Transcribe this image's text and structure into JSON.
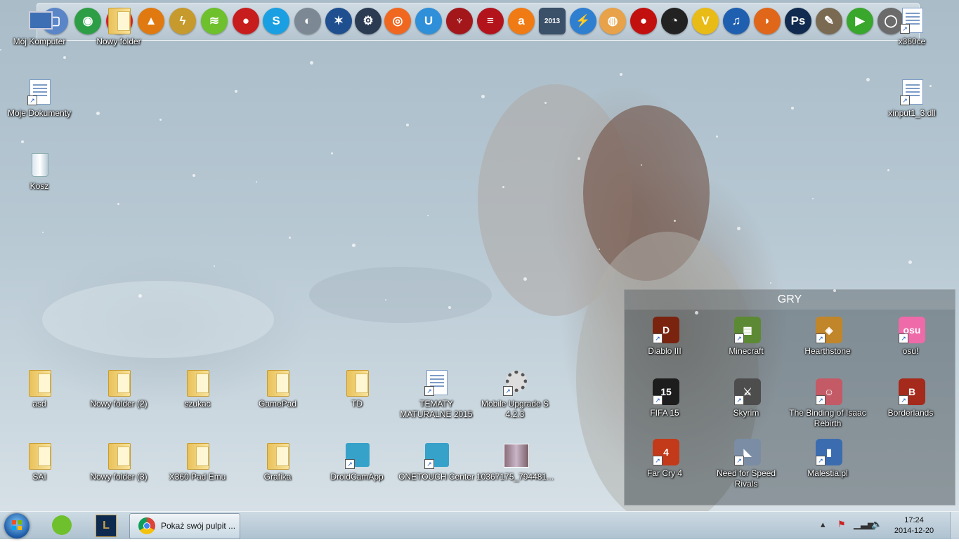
{
  "dock": {
    "icons": [
      {
        "name": "computer-icon",
        "glyph": "▢",
        "color": "#5a86c8"
      },
      {
        "name": "chrome-icon",
        "glyph": "◉",
        "color": "#2e9e46"
      },
      {
        "name": "opera-icon",
        "glyph": "O",
        "color": "#d5222b"
      },
      {
        "name": "aimp-icon",
        "glyph": "▲",
        "color": "#e07a10"
      },
      {
        "name": "winamp-icon",
        "glyph": "ϟ",
        "color": "#c69a2c"
      },
      {
        "name": "spotify-icon",
        "glyph": "≋",
        "color": "#6ec02d"
      },
      {
        "name": "speaker-icon",
        "glyph": "●",
        "color": "#c81d1d"
      },
      {
        "name": "skype-icon",
        "glyph": "S",
        "color": "#1aa0e2"
      },
      {
        "name": "steam-alt-icon",
        "glyph": "◐",
        "color": "#7d8895"
      },
      {
        "name": "battlenet-icon",
        "glyph": "✶",
        "color": "#1f4f8f"
      },
      {
        "name": "steam-icon",
        "glyph": "⚙",
        "color": "#2a3b52"
      },
      {
        "name": "origin-icon",
        "glyph": "◎",
        "color": "#f0681f"
      },
      {
        "name": "uplay-icon",
        "glyph": "U",
        "color": "#2f8fd8"
      },
      {
        "name": "hawk-icon",
        "glyph": "♆",
        "color": "#a3171b"
      },
      {
        "name": "stripes-icon",
        "glyph": "≡",
        "color": "#b3141b"
      },
      {
        "name": "avast-icon",
        "glyph": "a",
        "color": "#f07b14"
      },
      {
        "name": "game-2013-icon",
        "glyph": "2013",
        "color": "#3b5069"
      },
      {
        "name": "speedtest-icon",
        "glyph": "⚡",
        "color": "#2f7fd1"
      },
      {
        "name": "disc-icon",
        "glyph": "◍",
        "color": "#e7a24a"
      },
      {
        "name": "record-icon",
        "glyph": "●",
        "color": "#c2100f"
      },
      {
        "name": "obs-icon",
        "glyph": "◔",
        "color": "#222222"
      },
      {
        "name": "v-logo-icon",
        "glyph": "V",
        "color": "#e9bb16"
      },
      {
        "name": "headphones-icon",
        "glyph": "♫",
        "color": "#1f5fb0"
      },
      {
        "name": "shell-icon",
        "glyph": "◗",
        "color": "#e0661a"
      },
      {
        "name": "photoshop-icon",
        "glyph": "Ps",
        "color": "#102b4f"
      },
      {
        "name": "gimp-icon",
        "glyph": "✎",
        "color": "#7a6a52"
      },
      {
        "name": "play-icon",
        "glyph": "▶",
        "color": "#39a62c"
      },
      {
        "name": "steering-wheel-icon",
        "glyph": "◯",
        "color": "#6b6b6b"
      }
    ]
  },
  "desktop": {
    "left_top": [
      {
        "label": "Mój Komputer",
        "glyph": "computer"
      },
      {
        "label": "Nowy folder",
        "glyph": "folder"
      },
      {
        "label": "Moje Dokumenty",
        "glyph": "doc"
      },
      {
        "label": "Kosz",
        "glyph": "bin"
      }
    ],
    "right_top": [
      {
        "label": "x360ce",
        "glyph": "doc"
      },
      {
        "label": "xinput1_3.dll",
        "glyph": "doc"
      }
    ],
    "row1": [
      {
        "label": "asd",
        "glyph": "folder"
      },
      {
        "label": "Nowy folder (2)",
        "glyph": "folder"
      },
      {
        "label": "szukac",
        "glyph": "folder"
      },
      {
        "label": "GamePad",
        "glyph": "folder"
      },
      {
        "label": "TD",
        "glyph": "folder"
      },
      {
        "label": "TEMATY MATURALNE 2015",
        "glyph": "doc"
      },
      {
        "label": "Mobile Upgrade S 4.2.3",
        "glyph": "gear"
      }
    ],
    "row2": [
      {
        "label": "SAI",
        "glyph": "folder"
      },
      {
        "label": "Nowy folder (3)",
        "glyph": "folder"
      },
      {
        "label": "X360 Pad Emu",
        "glyph": "folder"
      },
      {
        "label": "Grafika",
        "glyph": "folder"
      },
      {
        "label": "DroidCamApp",
        "glyph": "app"
      },
      {
        "label": "ONETOUCH Center",
        "glyph": "app"
      },
      {
        "label": "10367175_794481...",
        "glyph": "image"
      }
    ]
  },
  "fence": {
    "title": "GRY",
    "items": [
      {
        "label": "Diablo III",
        "color": "#7a2410",
        "glyph": "D"
      },
      {
        "label": "Minecraft",
        "color": "#5c8a34",
        "glyph": "▦"
      },
      {
        "label": "Hearthstone",
        "color": "#c1862a",
        "glyph": "◈"
      },
      {
        "label": "osu!",
        "color": "#ef6aa9",
        "glyph": "osu"
      },
      {
        "label": "FIFA 15",
        "color": "#1d1d1d",
        "glyph": "15"
      },
      {
        "label": "Skyrim",
        "color": "#4d4d4d",
        "glyph": "⚔"
      },
      {
        "label": "The Binding of Isaac Rebirth",
        "color": "#c35a66",
        "glyph": "☺"
      },
      {
        "label": "Borderlands",
        "color": "#a52a1c",
        "glyph": "B"
      },
      {
        "label": "Far Cry 4",
        "color": "#c33a1a",
        "glyph": "4"
      },
      {
        "label": "Need for Speed Rivals",
        "color": "#7a8da4",
        "glyph": "◣"
      },
      {
        "label": "Malestia.pl",
        "color": "#3b6cb0",
        "glyph": "▮"
      }
    ]
  },
  "taskbar": {
    "active_window": "Pokaż swój pulpit ...",
    "clock_time": "17:24",
    "clock_date": "2014-12-20"
  }
}
